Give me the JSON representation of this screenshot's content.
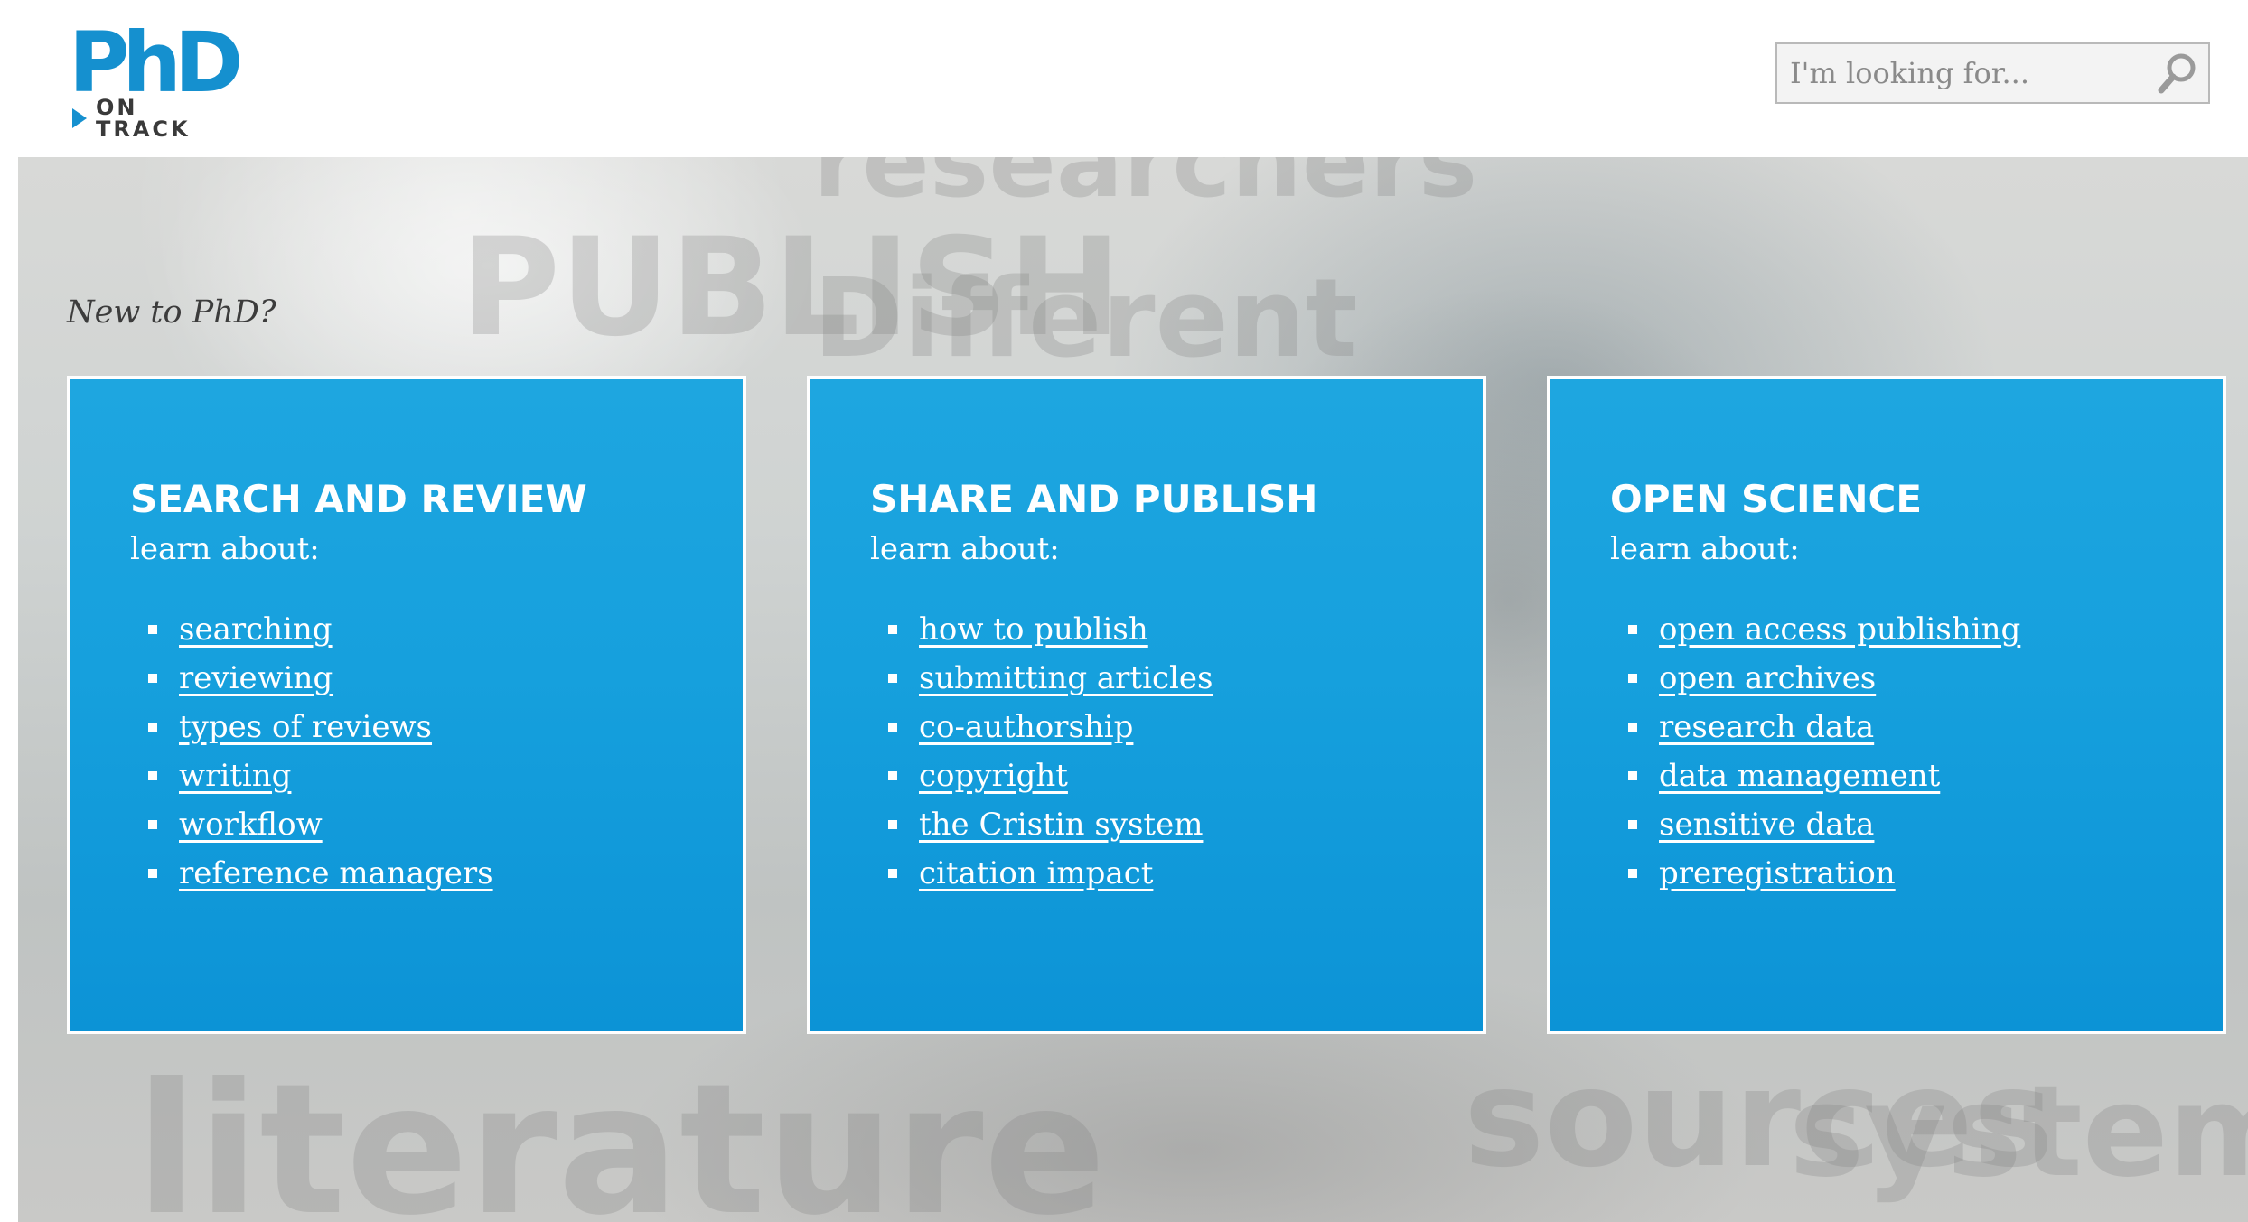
{
  "header": {
    "logo": {
      "main": "PhD",
      "sub": "ON TRACK"
    },
    "search": {
      "placeholder": "I'm looking for..."
    }
  },
  "hero": {
    "intro": "New to PhD?",
    "background_words": [
      "PUBLISH",
      "Different",
      "literature",
      "sources",
      "system",
      "researchers"
    ]
  },
  "cards": [
    {
      "title": "SEARCH AND REVIEW",
      "subtitle": "learn about:",
      "links": [
        "searching",
        "reviewing",
        "types of reviews",
        "writing",
        "workflow",
        "reference managers"
      ]
    },
    {
      "title": "SHARE AND PUBLISH",
      "subtitle": "learn about:",
      "links": [
        "how to publish",
        "submitting articles",
        "co-authorship",
        "copyright",
        "the Cristin system",
        "citation impact"
      ]
    },
    {
      "title": "OPEN SCIENCE",
      "subtitle": "learn about:",
      "links": [
        "open access publishing",
        "open archives",
        "research data",
        "data management",
        "sensitive data",
        "preregistration"
      ]
    }
  ],
  "colors": {
    "brand_blue": "#1590cf",
    "card_blue": "#16a0dd",
    "logo_text": "#3a3a3a"
  }
}
